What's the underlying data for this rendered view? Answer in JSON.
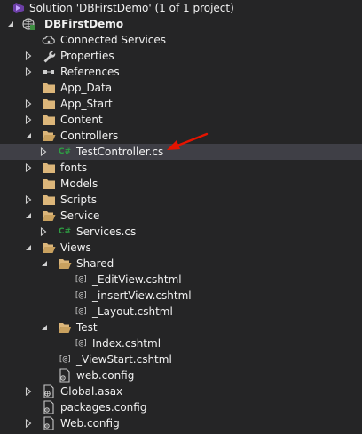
{
  "solution": {
    "label": "Solution 'DBFirstDemo' (1 of 1 project)"
  },
  "project": {
    "label": "DBFirstDemo"
  },
  "items": {
    "connected_services": "Connected Services",
    "properties": "Properties",
    "references": "References",
    "app_data": "App_Data",
    "app_start": "App_Start",
    "content": "Content",
    "controllers": "Controllers",
    "test_controller": "TestController.cs",
    "fonts": "fonts",
    "models": "Models",
    "scripts": "Scripts",
    "service": "Service",
    "services_cs": "Services.cs",
    "views": "Views",
    "shared": "Shared",
    "edit_view": "_EditView.cshtml",
    "insert_view": "_insertView.cshtml",
    "layout": "_Layout.cshtml",
    "test_folder": "Test",
    "index": "Index.cshtml",
    "viewstart": "_ViewStart.cshtml",
    "views_web_config": "web.config",
    "global_asax": "Global.asax",
    "packages_config": "packages.config",
    "root_web_config": "Web.config"
  },
  "glyphs": {
    "csharp": "C#",
    "razor": "[@]"
  },
  "colors": {
    "background": "#252526",
    "selected_row": "#3f3f46",
    "folder": "#dcb67a",
    "csharp": "#2ea043",
    "annotation_arrow": "#e51400"
  }
}
